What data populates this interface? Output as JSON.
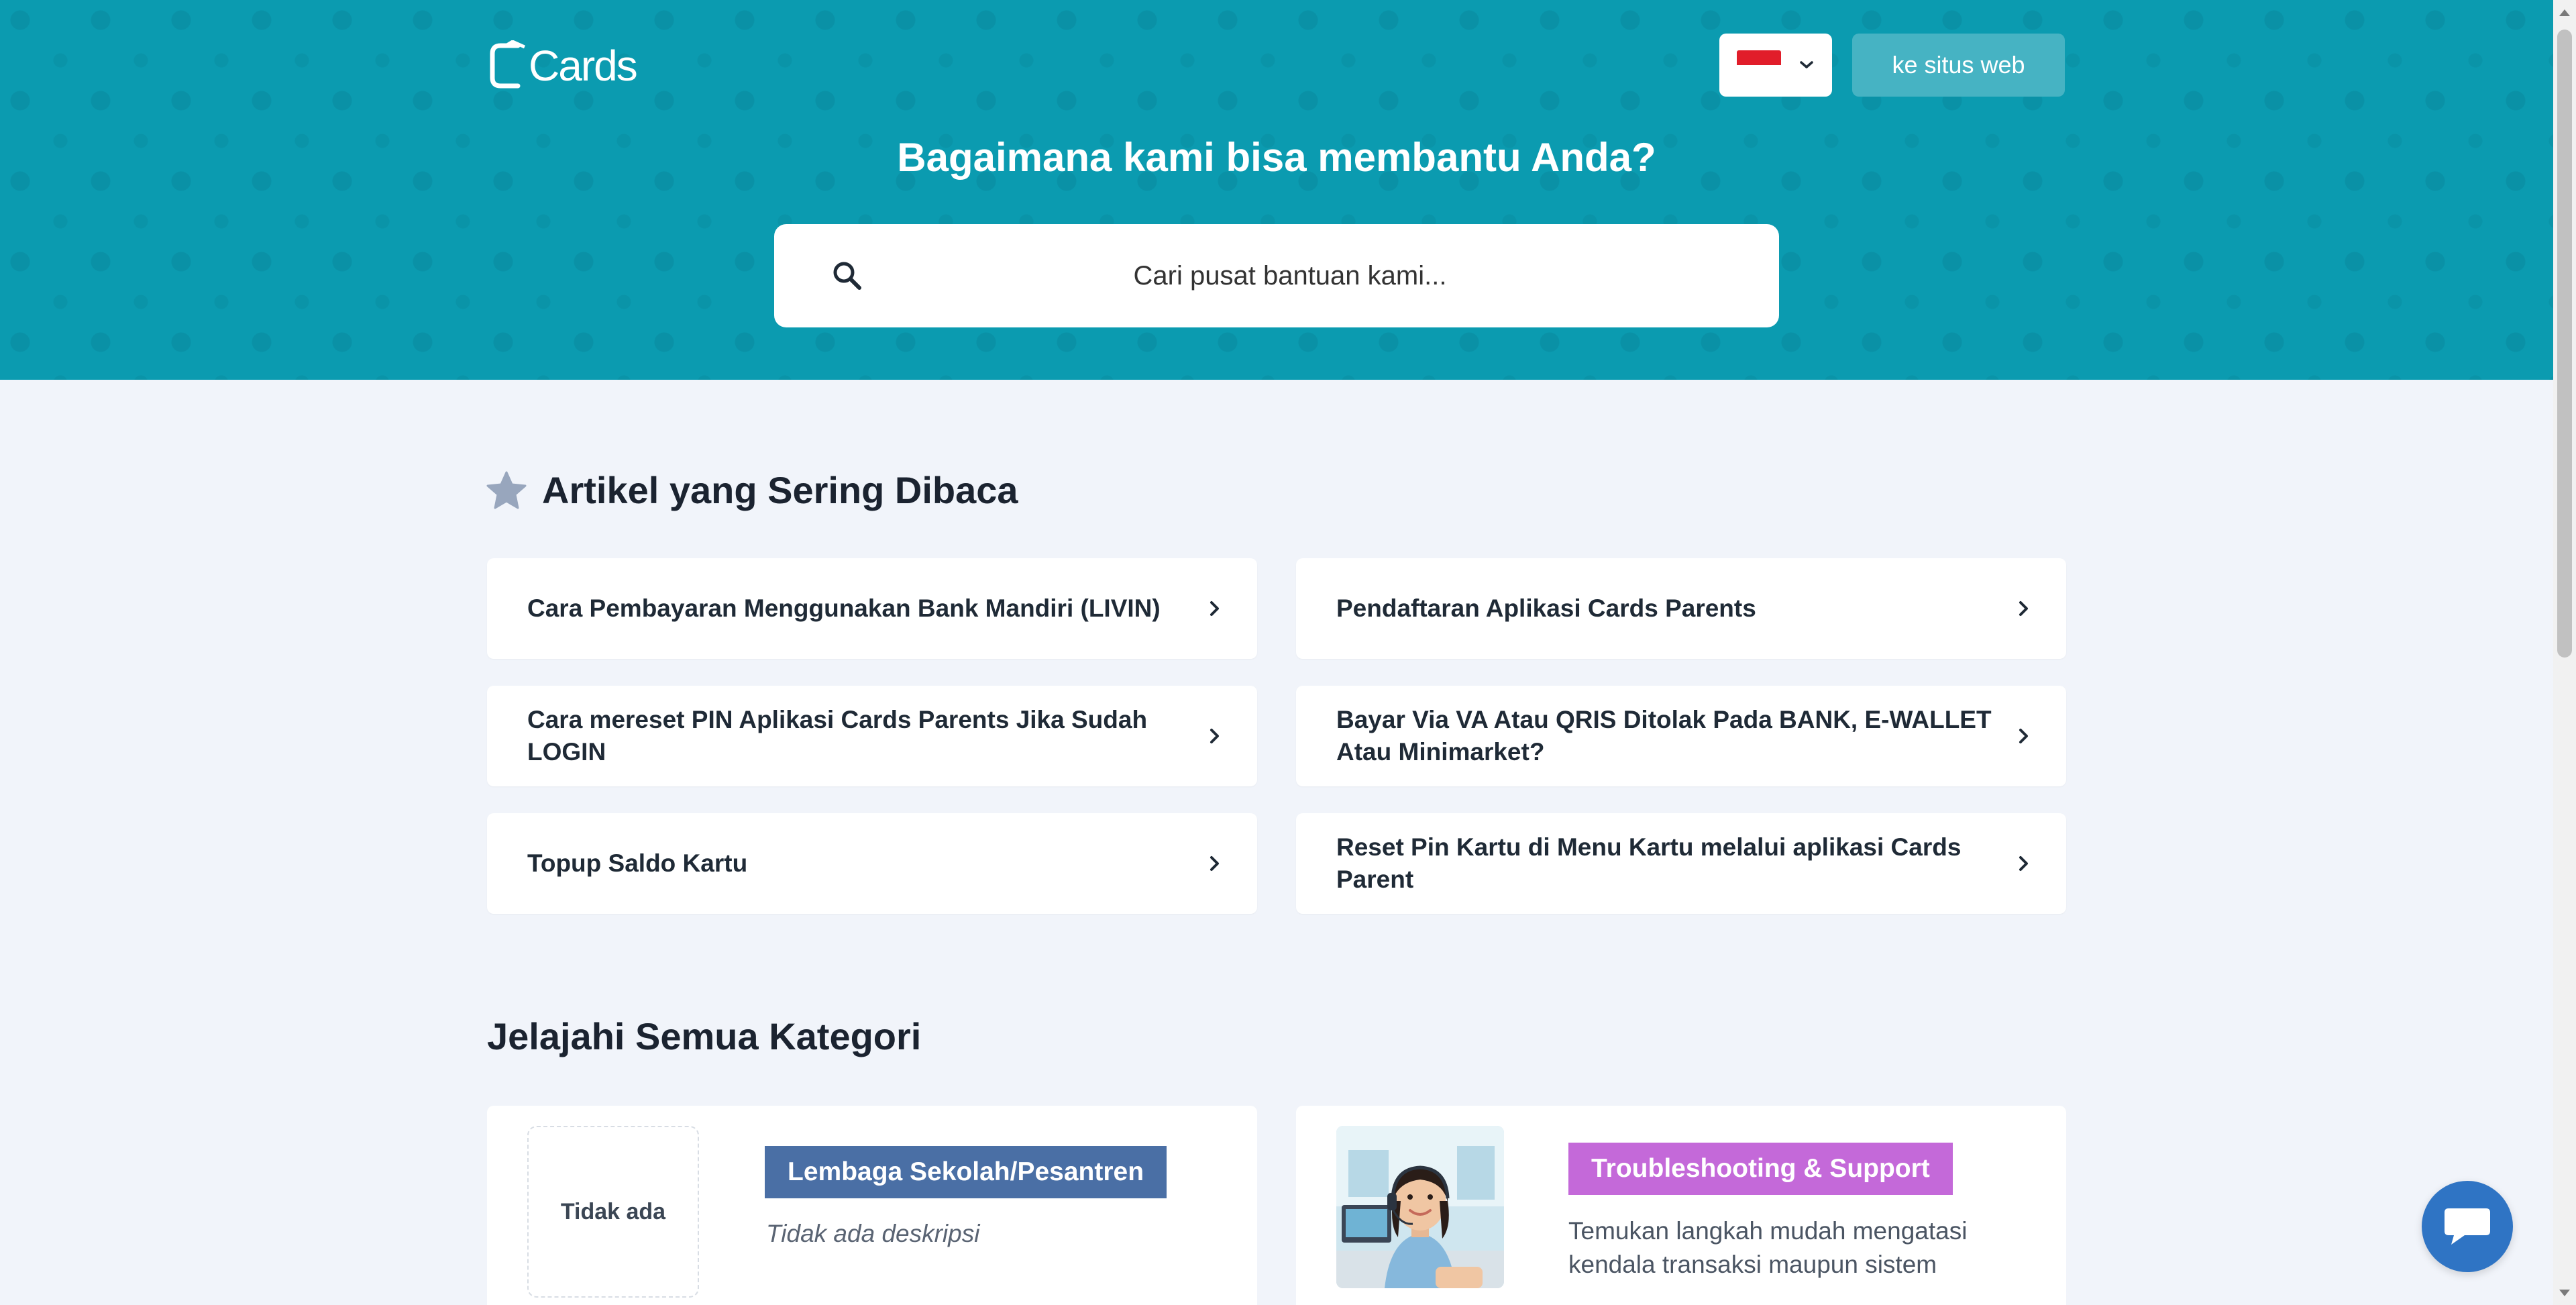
{
  "header": {
    "logo_text": "Cards",
    "site_button_label": "ke situs web",
    "language_flag": "indonesia-flag-icon",
    "title": "Bagaimana kami bisa membantu Anda?",
    "search_placeholder": "Cari pusat bantuan kami..."
  },
  "popular": {
    "title": "Artikel yang Sering Dibaca",
    "articles": [
      "Cara Pembayaran Menggunakan Bank Mandiri (LIVIN)",
      "Pendaftaran Aplikasi Cards Parents",
      "Cara mereset PIN Aplikasi Cards Parents Jika Sudah LOGIN",
      "Bayar Via VA Atau QRIS Ditolak Pada BANK, E-WALLET Atau Minimarket?",
      "Topup Saldo Kartu",
      "Reset Pin Kartu di Menu Kartu melalui aplikasi Cards Parent"
    ]
  },
  "categories": {
    "title": "Jelajahi Semua Kategori",
    "items": [
      {
        "image_placeholder": "Tidak ada",
        "name": "Lembaga Sekolah/Pesantren",
        "description": "Tidak ada deskripsi",
        "badge_color": "#4a6fa5"
      },
      {
        "name": "Troubleshooting & Support",
        "description": "Temukan langkah mudah mengatasi kendala transaksi maupun sistem",
        "badge_color": "#c469d9"
      }
    ]
  },
  "colors": {
    "hero": "#0b9bb0",
    "page_background": "#f1f4fa",
    "chat_button": "#2f74c4"
  }
}
